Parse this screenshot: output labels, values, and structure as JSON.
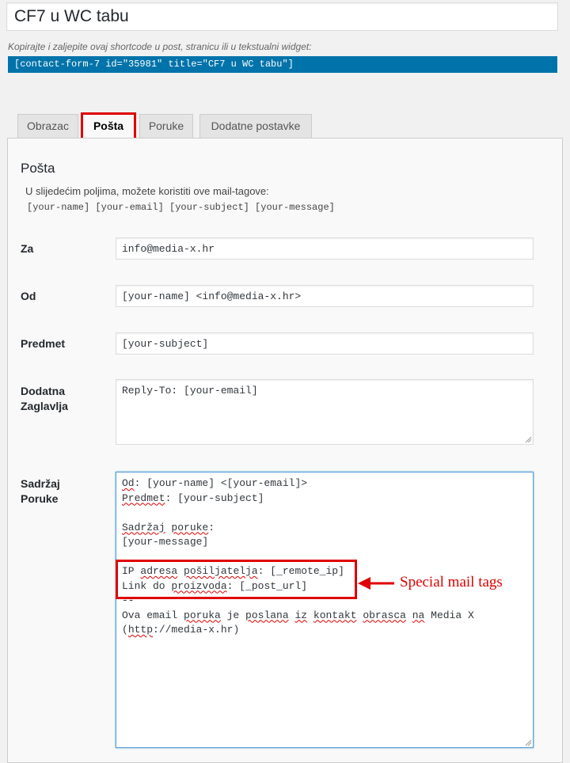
{
  "form_title": "CF7 u WC tabu",
  "shortcode_hint": "Kopirajte i zaljepite ovaj shortcode u post, stranicu ili u tekstualni widget:",
  "shortcode": "[contact-form-7 id=\"35981\" title=\"CF7 u WC tabu\"]",
  "tabs": [
    {
      "label": "Obrazac",
      "active": false
    },
    {
      "label": "Pošta",
      "active": true
    },
    {
      "label": "Poruke",
      "active": false
    },
    {
      "label": "Dodatne postavke",
      "active": false
    }
  ],
  "mail_panel": {
    "heading": "Pošta",
    "description": "U slijedećim poljima, možete koristiti ove mail-tagove:",
    "mail_tags": "[your-name] [your-email] [your-subject] [your-message]",
    "to": {
      "label": "Za",
      "value": "info@media-x.hr"
    },
    "from": {
      "label": "Od",
      "value": "[your-name] <info@media-x.hr>"
    },
    "subject": {
      "label": "Predmet",
      "value": "[your-subject]"
    },
    "additional_headers": {
      "label_line1": "Dodatna",
      "label_line2": "Zaglavlja",
      "value": "Reply-To: [your-email]"
    },
    "message_body": {
      "label_line1": "Sadržaj",
      "label_line2": "Poruke",
      "lines": [
        "Od: [your-name] <[your-email]>",
        "Predmet: [your-subject]",
        "",
        "Sadržaj poruke:",
        "[your-message]",
        "",
        "IP adresa pošiljatelja: [_remote_ip]",
        "Link do proizvoda: [_post_url]",
        "--",
        "Ova email poruka je poslana iz kontakt obrasca na Media X",
        "(http://media-x.hr)"
      ]
    }
  },
  "annotation": {
    "text": "Special mail tags",
    "color": "#e00000"
  },
  "colors": {
    "accent": "#0073aa",
    "highlight": "#e00000",
    "background": "#f1f1f1"
  }
}
